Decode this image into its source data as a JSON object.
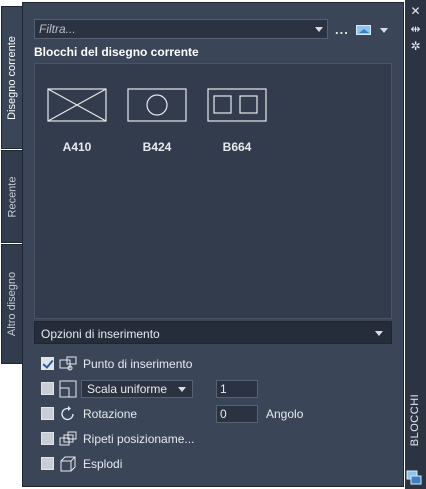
{
  "tabs": {
    "current": "Disegno corrente",
    "recent": "Recente",
    "other": "Altro disegno"
  },
  "palette_title": "BLOCCHI",
  "title_buttons": {
    "close": "✕",
    "autohide": "⇹",
    "properties": "✲"
  },
  "filter": {
    "placeholder": "Filtra...",
    "more": "...",
    "view_icon": "thumbnail-view-icon"
  },
  "section_title": "Blocchi del disegno corrente",
  "blocks": [
    {
      "name": "A410",
      "icon": "box-cross-icon"
    },
    {
      "name": "B424",
      "icon": "box-circle-icon"
    },
    {
      "name": "B664",
      "icon": "box-two-squares-icon"
    }
  ],
  "options": {
    "header": "Opzioni di inserimento",
    "insertion_point": {
      "label": "Punto di inserimento",
      "checked": true
    },
    "scale": {
      "mode": "Scala uniforme",
      "value": "1",
      "checked": false
    },
    "rotation": {
      "label": "Rotazione",
      "value": "0",
      "unit": "Angolo",
      "checked": false
    },
    "repeat": {
      "label": "Ripeti posizioname...",
      "checked": false
    },
    "explode": {
      "label": "Esplodi",
      "checked": false
    }
  },
  "colors": {
    "panel": "#3b4558",
    "dark": "#262d3a",
    "text": "#e7eaef",
    "accent": "#8fc3f0"
  }
}
